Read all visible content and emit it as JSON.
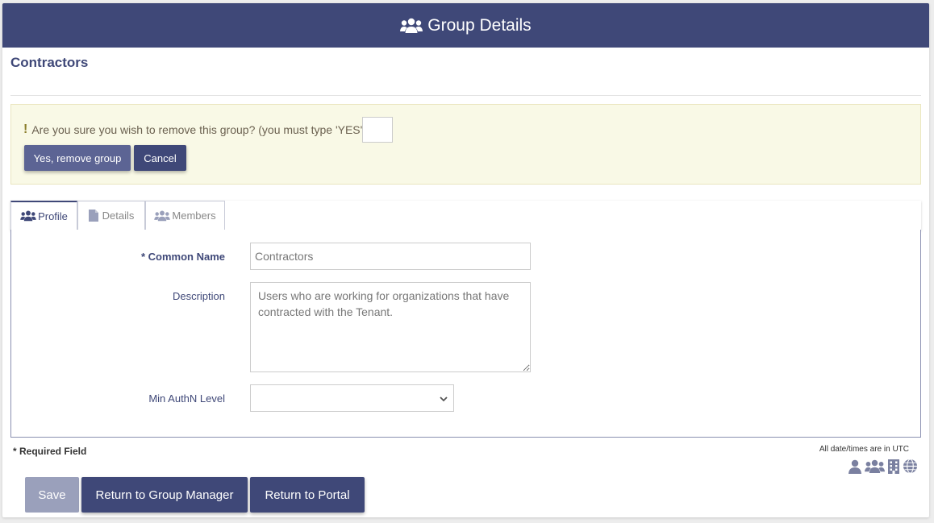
{
  "header": {
    "title": "Group Details",
    "icon": "users-icon"
  },
  "page": {
    "title": "Contractors"
  },
  "confirm": {
    "message": "Are you sure you wish to remove this group? (you must type 'YES')",
    "input_value": "",
    "yes_label": "Yes, remove group",
    "cancel_label": "Cancel"
  },
  "tabs": [
    {
      "label": "Profile",
      "icon": "users-icon",
      "active": true
    },
    {
      "label": "Details",
      "icon": "file-icon",
      "active": false
    },
    {
      "label": "Members",
      "icon": "users-icon",
      "active": false
    }
  ],
  "form": {
    "common_name": {
      "label": "* Common Name",
      "value": "Contractors"
    },
    "description": {
      "label": "Description",
      "value": "Users who are working for organizations that have contracted with the Tenant."
    },
    "min_authn": {
      "label": "Min AuthN Level",
      "value": ""
    }
  },
  "footer": {
    "required_note": "* Required Field",
    "utc_note": "All date/times are in UTC",
    "save_label": "Save",
    "return_group_label": "Return to Group Manager",
    "return_portal_label": "Return to Portal"
  },
  "colors": {
    "primary": "#3f4878",
    "secondary": "#5c6494",
    "alert_bg": "#f9f9e6"
  }
}
